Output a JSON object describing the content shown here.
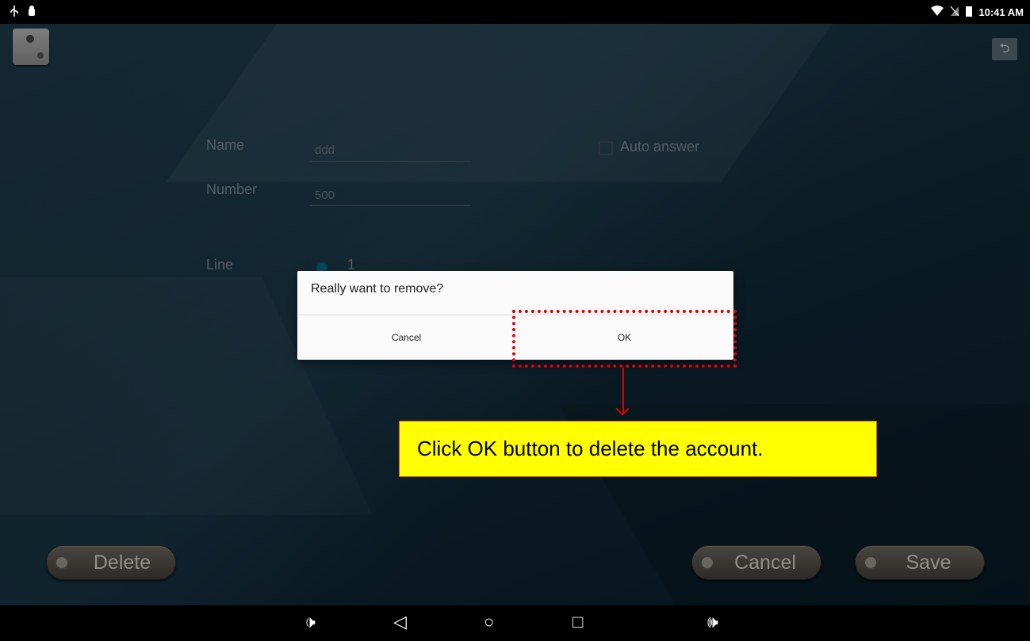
{
  "status_bar": {
    "left_icons": [
      "usb-icon",
      "android-debug-icon"
    ],
    "right_icons": [
      "wifi-icon",
      "no-sim-icon",
      "battery-icon"
    ],
    "time": "10:41 AM"
  },
  "header": {
    "logo_icon": "app-logo-icon",
    "back_icon": "reply-back-icon",
    "back_glyph": "⮌"
  },
  "form": {
    "name_label": "Name",
    "name_value": "ddd",
    "number_label": "Number",
    "number_value": "500",
    "auto_answer_label": "Auto answer",
    "line_label": "Line",
    "line_value": "1"
  },
  "dialog": {
    "title": "Really want to remove?",
    "cancel_label": "Cancel",
    "ok_label": "OK"
  },
  "callout": {
    "text": "Click OK button to delete the account."
  },
  "buttons": {
    "delete_label": "Delete",
    "cancel_label": "Cancel",
    "save_label": "Save"
  },
  "nav_bar": {
    "volume_down_glyph": "🕩",
    "back_glyph": "◁",
    "home_glyph": "○",
    "recents_glyph": "□",
    "volume_up_glyph": "🕪"
  },
  "colors": {
    "highlight": "#e00000",
    "callout_bg": "#ffff00",
    "background": "#173140"
  }
}
